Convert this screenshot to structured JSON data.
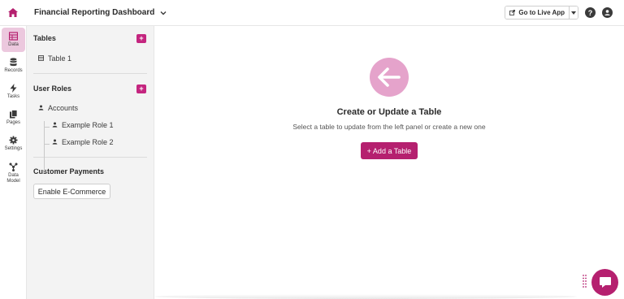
{
  "header": {
    "app_title": "Financial Reporting Dashboard",
    "live_button": "Go to Live App"
  },
  "rail": {
    "items": [
      {
        "label": "Data",
        "icon": "table-icon"
      },
      {
        "label": "Records",
        "icon": "database-icon"
      },
      {
        "label": "Tasks",
        "icon": "bolt-icon"
      },
      {
        "label": "Pages",
        "icon": "pages-icon"
      },
      {
        "label": "Settings",
        "icon": "gear-icon"
      },
      {
        "label": "Data Model",
        "icon": "data-model-icon"
      }
    ]
  },
  "panel": {
    "tables_title": "Tables",
    "tables": [
      "Table 1"
    ],
    "roles_title": "User Roles",
    "roles_root": "Accounts",
    "roles": [
      "Example Role 1",
      "Example Role 2"
    ],
    "payments_title": "Customer Payments",
    "ecommerce_button": "Enable E-Commerce",
    "plus": "+"
  },
  "main": {
    "title": "Create or Update a Table",
    "subtitle": "Select a table to update from the left panel or create a new one",
    "add_button": "+ Add a Table"
  },
  "colors": {
    "accent": "#c4257f",
    "accent_dark": "#b5206f",
    "icon_bg": "#e5a3cb",
    "rail_active": "#ecc8de"
  }
}
